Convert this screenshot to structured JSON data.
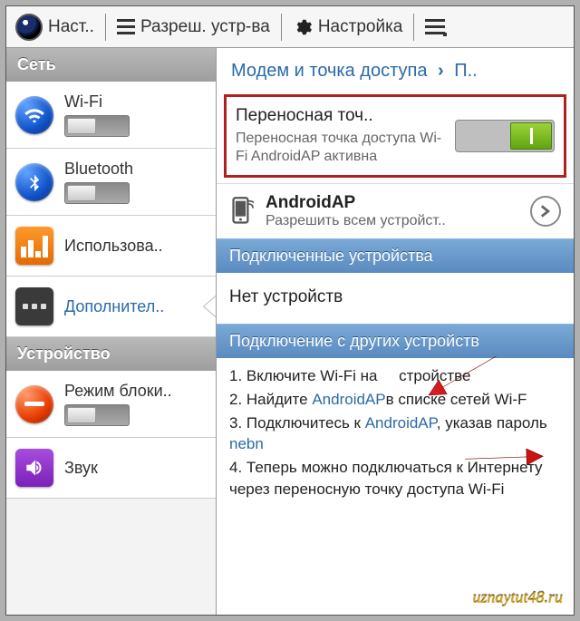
{
  "toolbar": {
    "settings_label": "Наст..",
    "permissions_label": "Разреш. устр-ва",
    "config_label": "Настройка"
  },
  "sidebar": {
    "section_network": "Сеть",
    "section_device": "Устройство",
    "items": {
      "wifi": "Wi-Fi",
      "bluetooth": "Bluetooth",
      "usage": "Использова..",
      "more": "Дополнител..",
      "lock": "Режим блоки..",
      "sound": "Звук"
    }
  },
  "breadcrumb": {
    "parent": "Модем и точка доступа",
    "child": "П.."
  },
  "hotspot": {
    "title": "Переносная точ..",
    "subtitle": "Переносная точка доступа Wi-Fi AndroidAP активна",
    "toggle_on": true
  },
  "ap": {
    "name": "AndroidAP",
    "sub": "Разрешить всем устройст.."
  },
  "headers": {
    "connected": "Подключенные устройства",
    "other": "Подключение с других устройств"
  },
  "no_devices": "Нет устройств",
  "steps": {
    "s1a": "1. Включите Wi-Fi на",
    "s1b": "стройстве",
    "s2a": "2. Найдите ",
    "s2_link": "AndroidAP",
    "s2b": "в списке сетей Wi-F",
    "s3a": "3. Подключитесь к ",
    "s3_link": "AndroidAP",
    "s3b": ", указав пароль ",
    "s3_pwd": "nebn",
    "s4": "4. Теперь можно подключаться к Интернету через переносную точку доступа Wi-Fi"
  },
  "watermark": "uznaytut48.ru"
}
